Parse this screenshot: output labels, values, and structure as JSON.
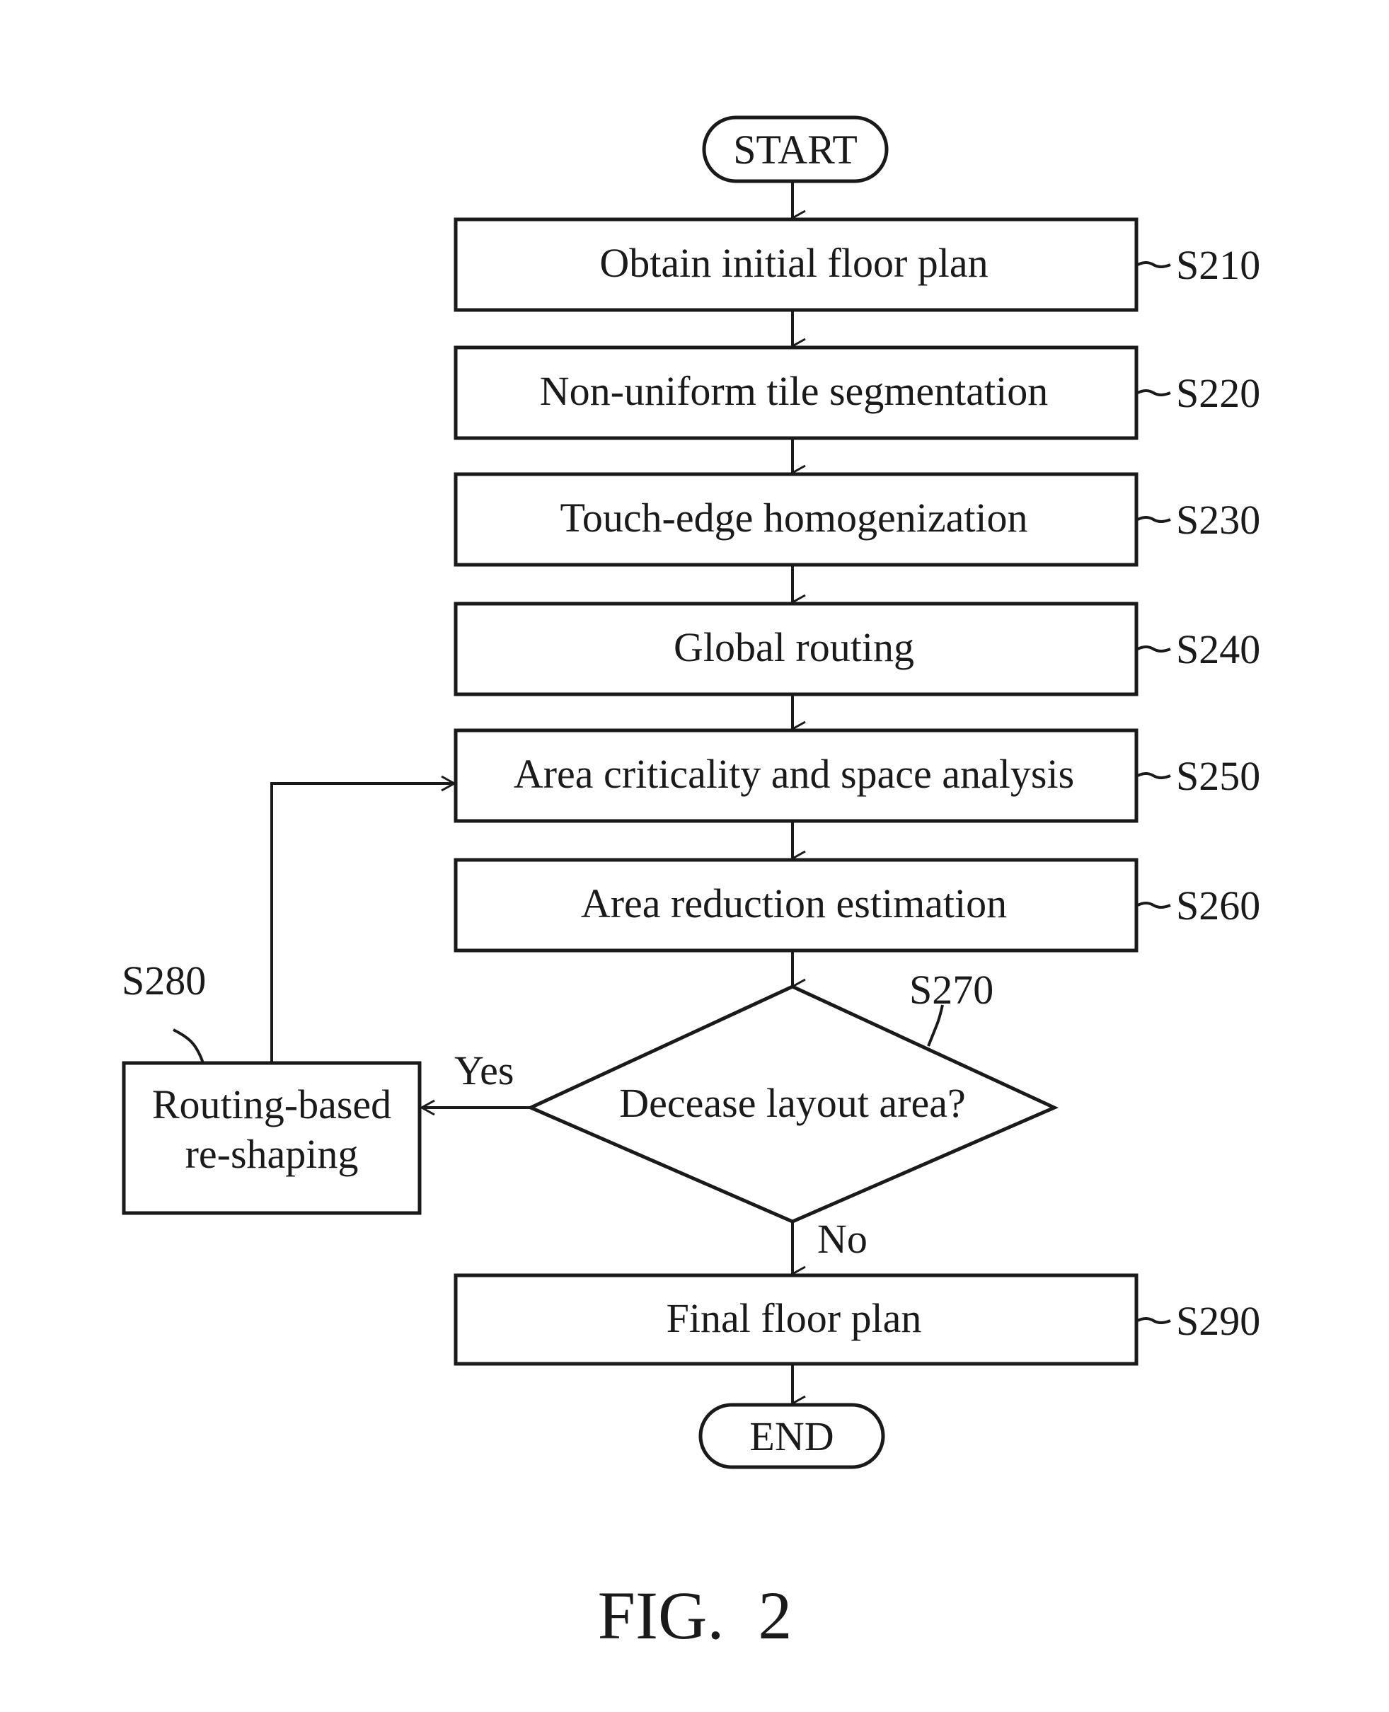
{
  "figure": {
    "caption": "FIG.  2",
    "start_label": "START",
    "end_label": "END",
    "steps": [
      {
        "id": "S210",
        "label": "Obtain initial floor plan"
      },
      {
        "id": "S220",
        "label": "Non-uniform tile segmentation"
      },
      {
        "id": "S230",
        "label": "Touch-edge homogenization"
      },
      {
        "id": "S240",
        "label": "Global routing"
      },
      {
        "id": "S250",
        "label": "Area criticality and space analysis"
      },
      {
        "id": "S260",
        "label": "Area reduction estimation"
      },
      {
        "id": "S290",
        "label": "Final floor plan"
      }
    ],
    "decision": {
      "id": "S270",
      "label": "Decease layout area?",
      "yes_label": "Yes",
      "no_label": "No"
    },
    "loop_step": {
      "id": "S280",
      "line1": "Routing-based",
      "line2": "re-shaping"
    }
  }
}
